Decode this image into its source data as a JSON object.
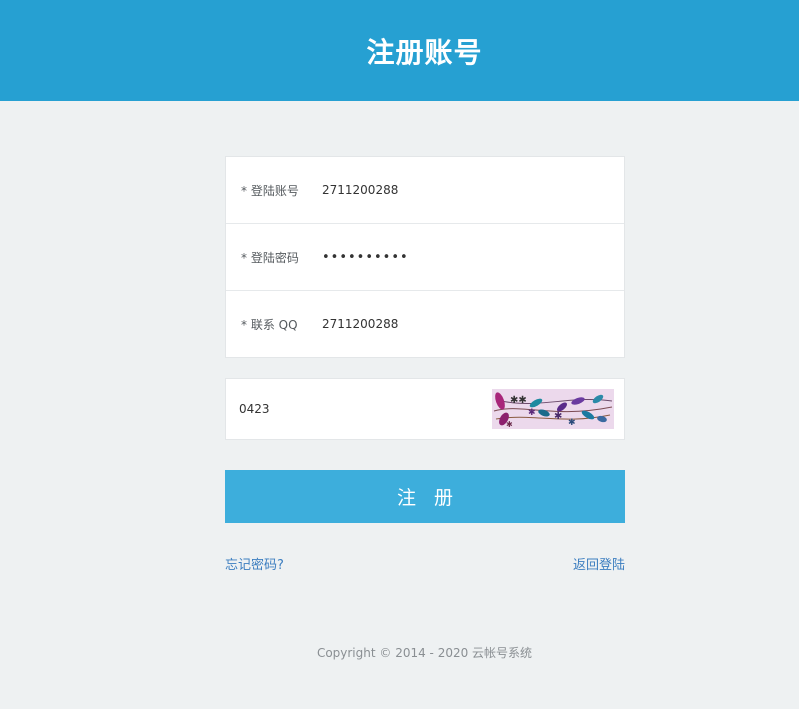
{
  "header": {
    "title": "注册账号",
    "background_color": "#26a0d2"
  },
  "form": {
    "fields": [
      {
        "label": "* 登陆账号",
        "value": "2711200288",
        "type": "text"
      },
      {
        "label": "* 登陆密码",
        "value": "••••••••••",
        "type": "password"
      },
      {
        "label": "* 联系 QQ",
        "value": "2711200288",
        "type": "text"
      }
    ]
  },
  "captcha": {
    "value": "0423",
    "image_icon": "captcha-image"
  },
  "submit": {
    "label": "注 册",
    "color": "#3daedc"
  },
  "links": {
    "forgot_password": "忘记密码?",
    "back_to_login": "返回登陆",
    "color": "#3c7ec0"
  },
  "footer": {
    "copyright": "Copyright © 2014 - 2020 云帐号系统"
  }
}
